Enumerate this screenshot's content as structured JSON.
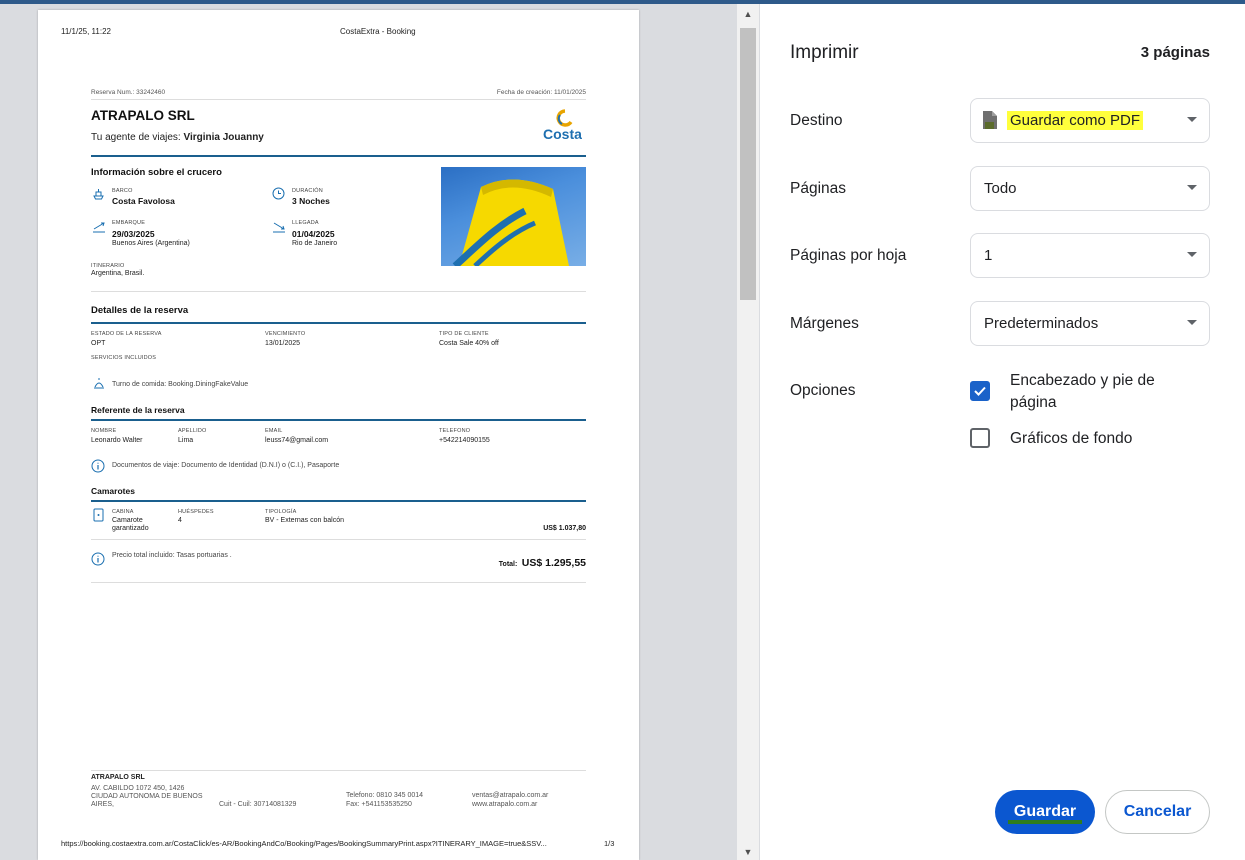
{
  "preview": {
    "header_datetime": "11/1/25, 11:22",
    "header_title": "CostaExtra - Booking",
    "footer_url": "https://booking.costaextra.com.ar/CostaClick/es-AR/BookingAndCo/Booking/Pages/BookingSummaryPrint.aspx?ITINERARY_IMAGE=true&SSV...",
    "footer_page": "1/3",
    "doc": {
      "reserva_num": "Reserva Num.: 33242460",
      "fecha_creacion": "Fecha de creación: 11/01/2025",
      "company": "ATRAPALO SRL",
      "agent_prefix": "Tu agente de viajes:",
      "agent_name": "Virginia Jouanny",
      "logo_text": "Costa",
      "cruise_title": "Información sobre el crucero",
      "barco_label": "BARCO",
      "barco_value": "Costa Favolosa",
      "duracion_label": "DURACIÓN",
      "duracion_value": "3 Noches",
      "embarque_label": "EMBARQUE",
      "embarque_date": "29/03/2025",
      "embarque_place": "Buenos Aires (Argentina)",
      "llegada_label": "LLEGADA",
      "llegada_date": "01/04/2025",
      "llegada_place": "Rio de Janeiro",
      "itinerario_label": "ITINERARIO",
      "itinerario_value": "Argentina, Brasil.",
      "reserva_title": "Detalles de la reserva",
      "estado_label": "ESTADO DE LA RESERVA",
      "estado_value": "OPT",
      "vencimiento_label": "VENCIMIENTO",
      "vencimiento_value": "13/01/2025",
      "tipo_label": "TIPO DE CLIENTE",
      "tipo_value": "Costa Sale 40% off",
      "servicios_label": "SERVICIOS INCLUIDOS",
      "turno_text": "Turno de comida: Booking.DiningFakeValue",
      "referente_title": "Referente de la reserva",
      "nombre_label": "NOMBRE",
      "nombre_value": "Leonardo Walter",
      "apellido_label": "APELLIDO",
      "apellido_value": "Lima",
      "email_label": "EMAIL",
      "email_value": "leuss74@gmail.com",
      "telefono_label": "TELEFONO",
      "telefono_value": "+542214090155",
      "documentos_text": "Documentos de viaje: Documento de Identidad (D.N.I) o (C.I.), Pasaporte",
      "camarotes_title": "Camarotes",
      "cabina_label": "CABINA",
      "cabina_value_1": "Camarote",
      "cabina_value_2": "garantizado",
      "huespedes_label": "HUÉSPEDES",
      "huespedes_value": "4",
      "tipologia_label": "TIPOLOGÍA",
      "tipologia_value": "BV - Externas con balcón",
      "cabin_price": "US$ 1.037,80",
      "precio_text": "Precio total incluido: Tasas portuarias .",
      "total_label": "Total:",
      "total_value": "US$ 1.295,55",
      "footer_company": "ATRAPALO SRL",
      "footer_addr_1": "AV. CABILDO 1072 450, 1426",
      "footer_addr_2": "CIUDAD AUTONOMA DE BUENOS",
      "footer_addr_3": "AIRES,",
      "footer_cuit": "Cuit - Cuil: 30714081329",
      "footer_tel": "Telefono: 0810 345 0014",
      "footer_fax": "Fax: +541153535250",
      "footer_email": "ventas@atrapalo.com.ar",
      "footer_web": "www.atrapalo.com.ar"
    }
  },
  "panel": {
    "title": "Imprimir",
    "pages_count": "3 páginas",
    "destino_label": "Destino",
    "destino_value": "Guardar como PDF",
    "paginas_label": "Páginas",
    "paginas_value": "Todo",
    "por_hoja_label": "Páginas por hoja",
    "por_hoja_value": "1",
    "margenes_label": "Márgenes",
    "margenes_value": "Predeterminados",
    "opciones_label": "Opciones",
    "encabezado_label_1": "Encabezado y pie de",
    "encabezado_label_2": "página",
    "encabezado_checked": true,
    "graficos_label": "Gráficos de fondo",
    "graficos_checked": false,
    "save_button": "Guardar",
    "cancel_button": "Cancelar"
  },
  "colors": {
    "accent": "#0b57d0",
    "highlight": "#ffff3c",
    "section_rule": "#1a5f8e",
    "costa_yellow": "#f6d900",
    "costa_blue": "#1e6fb0"
  }
}
